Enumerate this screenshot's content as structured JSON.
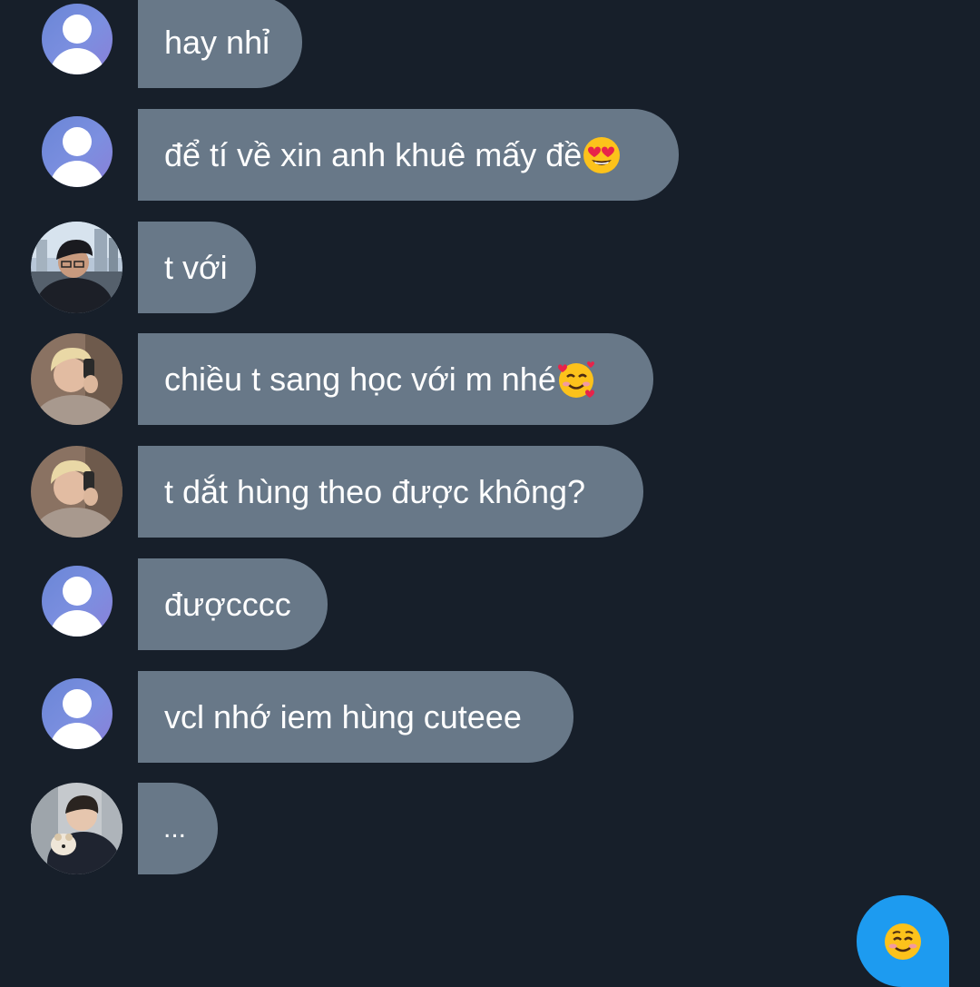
{
  "messages": [
    {
      "text": "hay nhỉ",
      "emoji": "",
      "avatar": "default-avatar"
    },
    {
      "text": "để tí về xin anh khuê mấy đề",
      "emoji": "heart-eyes",
      "avatar": "default-avatar"
    },
    {
      "text": "t với",
      "emoji": "",
      "avatar": "photo-avatar-glasses"
    },
    {
      "text": "chiều t sang học với m nhé",
      "emoji": "smiling-hearts",
      "avatar": "photo-avatar-blonde"
    },
    {
      "text": "t dắt hùng theo được không?",
      "emoji": "",
      "avatar": "photo-avatar-blonde"
    },
    {
      "text": "đượcccc",
      "emoji": "",
      "avatar": "default-avatar"
    },
    {
      "text": "vcl nhớ iem hùng cuteee",
      "emoji": "",
      "avatar": "default-avatar"
    },
    {
      "text": "...",
      "emoji": "",
      "avatar": "photo-avatar-dog"
    }
  ],
  "sent_message": {
    "emoji": "smiling-face-blush"
  },
  "colors": {
    "background": "#171f2a",
    "incoming_bubble": "#687888",
    "outgoing_bubble": "#1d9bf0",
    "text": "#ffffff"
  }
}
